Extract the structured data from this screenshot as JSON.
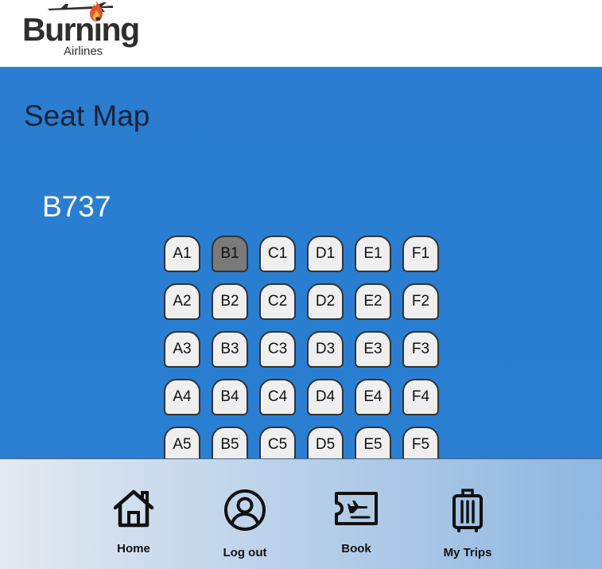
{
  "brand": {
    "name": "Burning",
    "subtitle": "Airlines"
  },
  "page": {
    "title": "Seat Map",
    "aircraft": "B737"
  },
  "seat_map": {
    "columns": [
      "A",
      "B",
      "C",
      "D",
      "E",
      "F"
    ],
    "rows": [
      1,
      2,
      3,
      4,
      5
    ],
    "taken": [
      "B1"
    ]
  },
  "nav": {
    "items": [
      {
        "label": "Home",
        "icon": "home-icon"
      },
      {
        "label": "Log out",
        "icon": "user-icon"
      },
      {
        "label": "Book",
        "icon": "ticket-icon"
      },
      {
        "label": "My Trips",
        "icon": "luggage-icon"
      }
    ]
  },
  "colors": {
    "main_background": "#2a7fd2",
    "seat_available": "#efefef",
    "seat_taken": "#7a7a7a",
    "title_text": "#17233a"
  }
}
